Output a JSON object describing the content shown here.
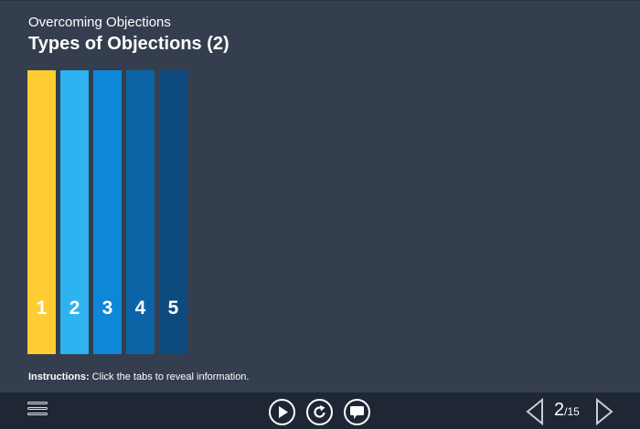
{
  "header": {
    "subtitle": "Overcoming Objections",
    "title": "Types of Objections (2)"
  },
  "tabs": [
    {
      "label": "1",
      "color": "#ffcc33"
    },
    {
      "label": "2",
      "color": "#2eb3f0"
    },
    {
      "label": "3",
      "color": "#0e87d8"
    },
    {
      "label": "4",
      "color": "#0c64a6"
    },
    {
      "label": "5",
      "color": "#0d4a7e"
    }
  ],
  "instructions": {
    "label": "Instructions:",
    "text": " Click the tabs to reveal information."
  },
  "controls": {
    "menu_icon": "hamburger-icon",
    "play_icon": "play-icon",
    "replay_icon": "replay-icon",
    "comment_icon": "speech-bubble-icon"
  },
  "pagination": {
    "current": "2",
    "total": "/15"
  }
}
